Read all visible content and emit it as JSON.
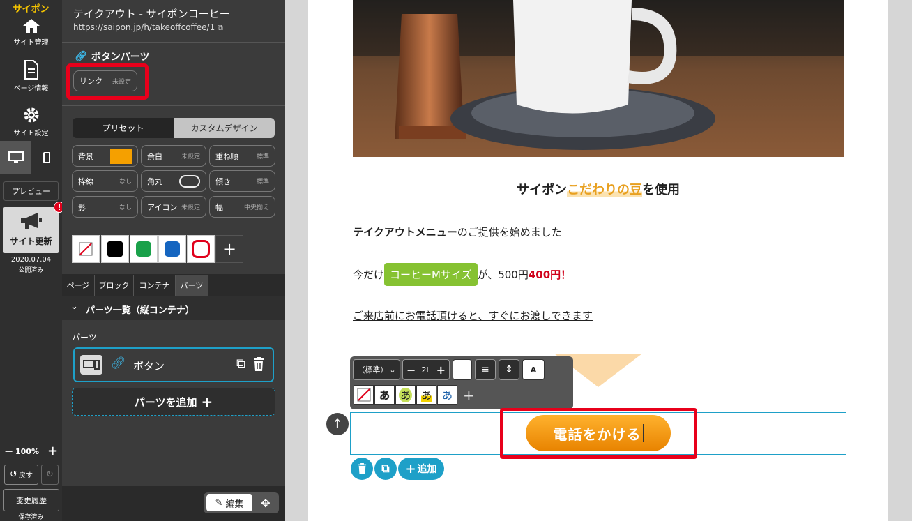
{
  "rail": {
    "logo": "サイポン",
    "site_manage": "サイト管理",
    "page_info": "ページ情報",
    "site_settings": "サイト設定",
    "preview": "プレビュー",
    "site_update": "サイト更新",
    "update_date": "2020.07.04",
    "update_status": "公開済み",
    "zoom": "100%",
    "undo": "戻す",
    "history": "変更履歴",
    "saved": "保存済み"
  },
  "panel": {
    "site_title": "テイクアウト - サイポンコーヒー",
    "site_url": "https://saipon.jp/h/takeoffcoffee/1",
    "section_title": "ボタンパーツ",
    "link_label": "リンク",
    "link_value": "未設定",
    "design_tabs": [
      "プリセット",
      "カスタムデザイン"
    ],
    "props": [
      {
        "label": "背景",
        "value": ""
      },
      {
        "label": "余白",
        "value": "未設定"
      },
      {
        "label": "重ね順",
        "value": "標準"
      },
      {
        "label": "枠線",
        "value": "なし"
      },
      {
        "label": "角丸",
        "value": ""
      },
      {
        "label": "傾き",
        "value": "標準"
      },
      {
        "label": "影",
        "value": "なし"
      },
      {
        "label": "アイコン",
        "value": "未設定"
      },
      {
        "label": "幅",
        "value": "中央揃え"
      }
    ],
    "bg_color": "#f5a000",
    "swatch_colors": [
      "#000000",
      "#1aa14a",
      "#1565c0"
    ],
    "nav_tabs": [
      "ページ",
      "ブロック",
      "コンテナ",
      "パーツ"
    ],
    "parts_list_title": "パーツ一覧（縦コンテナ）",
    "parts_label": "パーツ",
    "part_item": "ボタン",
    "add_part": "パーツを追加",
    "edit_mode": "編集"
  },
  "content": {
    "heading_pre": "サイポン",
    "heading_highlight": "こだわりの豆",
    "heading_post": "を使用",
    "line1_bold": "テイクアウトメニュー",
    "line1_rest": "のご提供を始めました",
    "line2_pre": "今だけ",
    "line2_tag": "コーヒーMサイズ",
    "line2_mid": "が、",
    "line2_old_price": "500円",
    "line2_new_price": "400円！",
    "line3": "ご来店前にお電話頂けると、すぐにお渡しできます",
    "button_text": "電話をかける",
    "add_label": "追加"
  },
  "toolbar": {
    "font_select": "（標準）",
    "size": "2L",
    "text_style_samples": [
      "あ",
      "あ",
      "あ",
      "あ"
    ],
    "a_label": "A"
  }
}
